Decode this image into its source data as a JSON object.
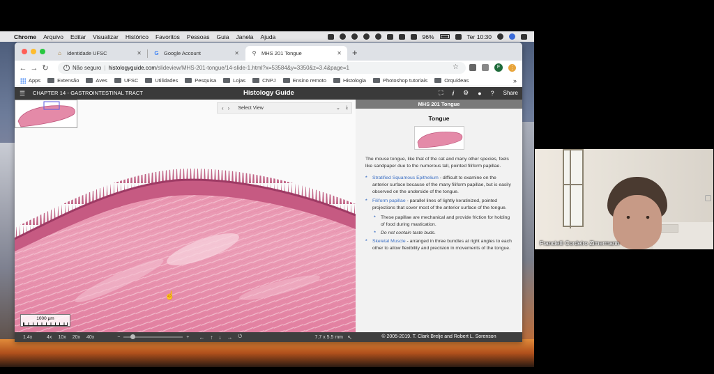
{
  "mac_menubar": {
    "items": [
      "Chrome",
      "Arquivo",
      "Editar",
      "Visualizar",
      "Histórico",
      "Favoritos",
      "Pessoas",
      "Guia",
      "Janela",
      "Ajuda"
    ],
    "battery": "96%",
    "clock": "Ter 10:30"
  },
  "browser": {
    "tabs": [
      {
        "label": "Identidade UFSC",
        "active": false
      },
      {
        "label": "Google Account",
        "active": false
      },
      {
        "label": "MHS 201 Tongue",
        "active": true
      }
    ],
    "security_label": "Não seguro",
    "url_host": "histologyguide.com",
    "url_path": "/slideview/MHS-201-tongue/14-slide-1.html?x=53584&y=3350&z=3.4&page=1",
    "avatar_letter": "F",
    "bookmarks": [
      "Apps",
      "Extensão",
      "Aves",
      "UFSC",
      "Utilidades",
      "Pesquisa",
      "Lojas",
      "CNPJ",
      "Ensino remoto",
      "Histologia",
      "Photoshop tutoriais",
      "Orquídeas"
    ]
  },
  "site": {
    "chapter": "CHAPTER 14 - GASTROINTESTINAL TRACT",
    "title": "Histology Guide",
    "share_label": "Share"
  },
  "viewer": {
    "select_view": "Select View",
    "scale_label": "1000 µm",
    "zoom_current": "1.4x",
    "zoom_buttons": [
      "4x",
      "10x",
      "20x",
      "40x"
    ],
    "dimensions": "7.7 x 5.5 mm"
  },
  "panel": {
    "title": "MHS 201 Tongue",
    "heading": "Tongue",
    "intro": "The mouse tongue, like that of the cat and many other species, feels like sandpaper due to the numerous tall, pointed filiform papillae.",
    "bullets": [
      {
        "link": "Stratified Squamous Epithelium",
        "text": " - difficult to examine on the anterior surface because of the many filiform papillae, but is easily observed on the underside of the tongue."
      },
      {
        "link": "Filiform papillae",
        "text": " - parallel lines of lightly keratinized, pointed projections that cover most of the anterior surface of the tongue."
      },
      {
        "link": "Skeletal Muscle",
        "text": " - arranged in three bundles at right angles to each other to allow flexibility and precision in movements of the tongue."
      }
    ],
    "subbullets": [
      "These papillae are mechanical and provide friction for holding of food during mastication.",
      "Do not contain taste buds."
    ],
    "copyright": "© 2005-2019. T. Clark Brelje and Robert L. Sorenson"
  },
  "webcam": {
    "participant_name": "Francielli Cordeiro Zimermann"
  },
  "colors": {
    "tissue_pink": "#e58aa6",
    "tissue_dark": "#b84a72",
    "link_blue": "#3b6fc4",
    "header_bg": "#3a3a3a"
  }
}
